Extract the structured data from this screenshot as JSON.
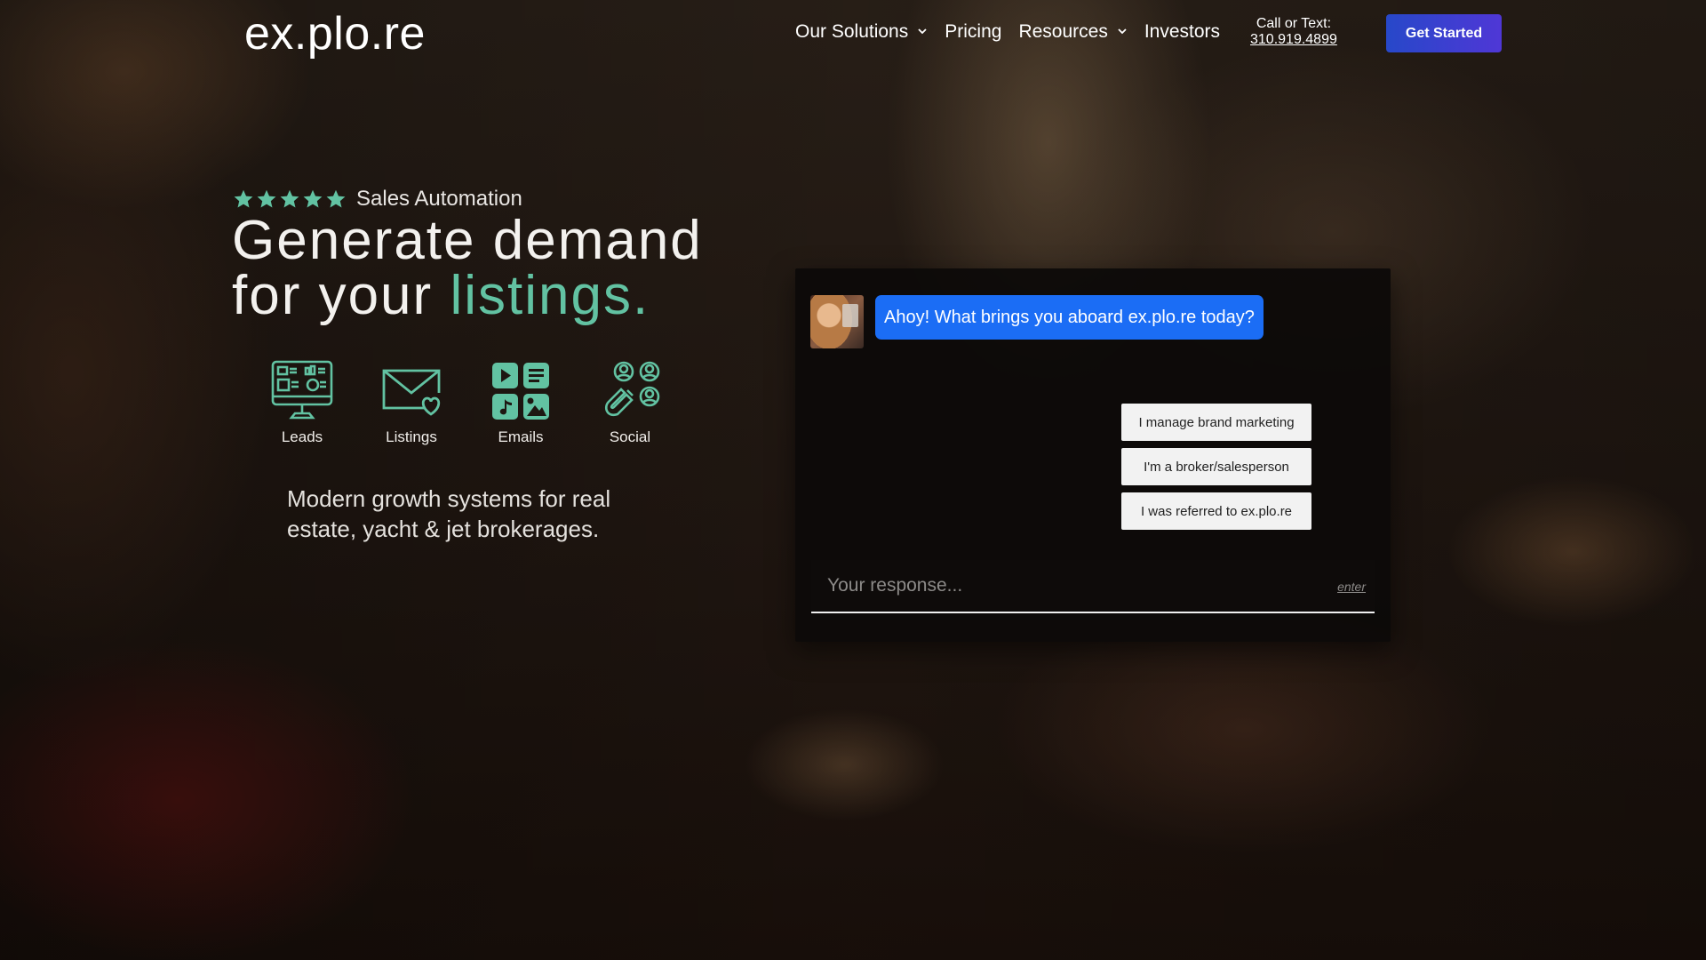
{
  "header": {
    "logo": "ex.plo.re",
    "nav": [
      {
        "label": "Our Solutions",
        "has_dropdown": true
      },
      {
        "label": "Pricing",
        "has_dropdown": false
      },
      {
        "label": "Resources",
        "has_dropdown": true
      },
      {
        "label": "Investors",
        "has_dropdown": false
      }
    ],
    "call_label": "Call or Text:",
    "phone": "310.919.4899",
    "cta_label": "Get Started"
  },
  "hero": {
    "rating_stars": 5,
    "rating_label": "Sales Automation",
    "headline_line1": "Generate demand",
    "headline_line2_prefix": "for your",
    "headline_accent": "listings.",
    "features": [
      {
        "label": "Leads",
        "icon": "monitor-dashboard-icon"
      },
      {
        "label": "Listings",
        "icon": "envelope-heart-icon"
      },
      {
        "label": "Emails",
        "icon": "media-grid-icon"
      },
      {
        "label": "Social",
        "icon": "users-magnet-icon"
      }
    ],
    "subcopy": "Modern growth systems for real estate, yacht & jet brokerages."
  },
  "chat": {
    "greeting": "Ahoy! What brings you aboard ex.plo.re today?",
    "options": [
      "I manage brand marketing",
      "I'm a broker/salesperson",
      "I was referred to ex.plo.re"
    ],
    "input_placeholder": "Your response...",
    "enter_hint": "enter"
  },
  "colors": {
    "accent_green": "#62c2a2",
    "bubble_blue": "#1b6df5",
    "cta_start": "#2748c9",
    "cta_end": "#4f37d6"
  }
}
